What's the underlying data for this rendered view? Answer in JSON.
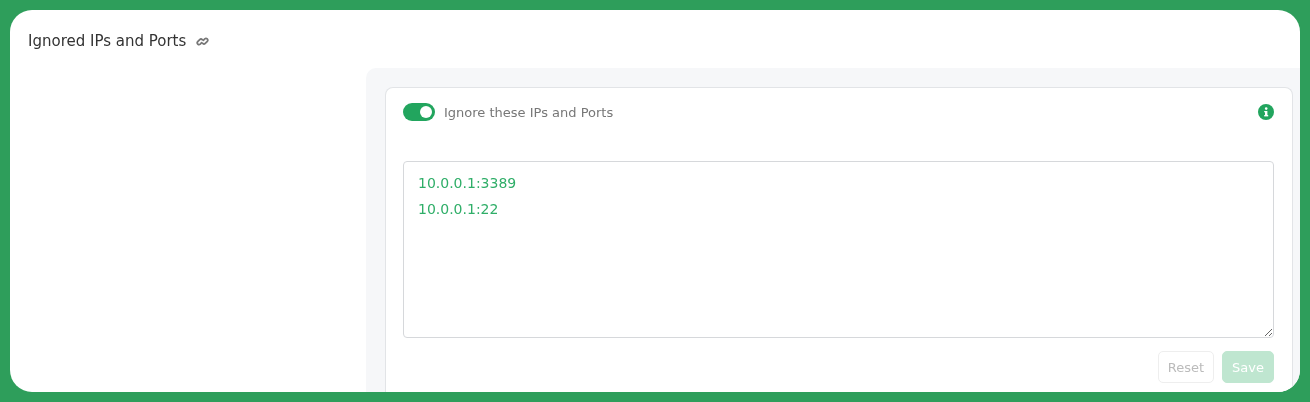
{
  "section": {
    "title": "Ignored IPs and Ports"
  },
  "toggle": {
    "label": "Ignore these IPs and Ports",
    "on": true
  },
  "textarea": {
    "value": "10.0.0.1:3389\n10.0.0.1:22"
  },
  "buttons": [
    {
      "label": "Reset",
      "kind": "secondary",
      "disabled": true
    },
    {
      "label": "Save",
      "kind": "primary",
      "disabled": true
    }
  ]
}
